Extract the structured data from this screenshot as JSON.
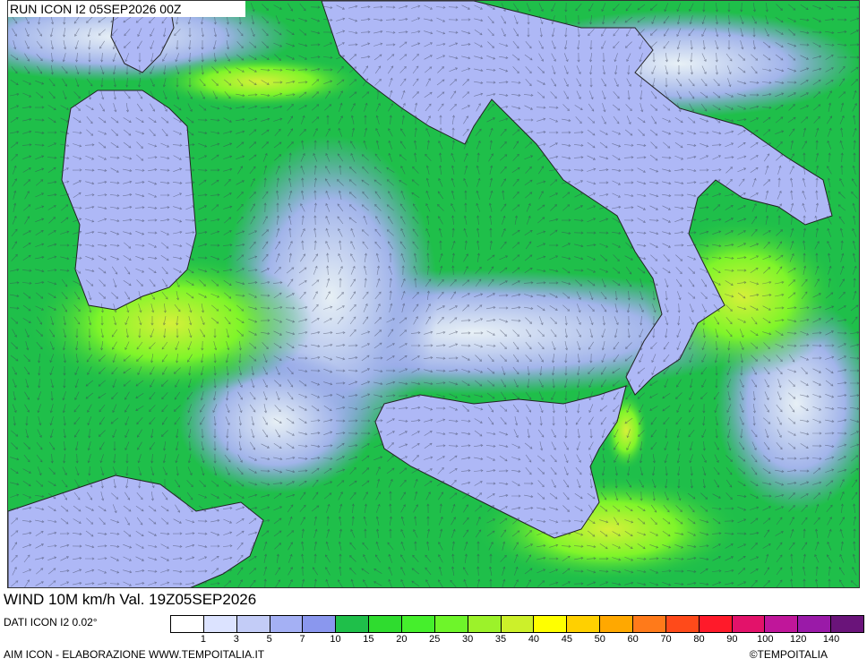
{
  "header": {
    "run_label": "RUN ICON I2 05SEP2026 00Z"
  },
  "footer": {
    "title": "WIND 10M km/h Val. 19Z05SEP2026",
    "source": "DATI ICON I2 0.02°",
    "credit": "AIM ICON - ELABORAZIONE WWW.TEMPOITALIA.IT",
    "copyright": "©TEMPOITALIA"
  },
  "legend": {
    "ticks": [
      "1",
      "3",
      "5",
      "7",
      "10",
      "15",
      "20",
      "25",
      "30",
      "35",
      "40",
      "45",
      "50",
      "60",
      "70",
      "80",
      "90",
      "100",
      "120",
      "140"
    ],
    "colors": [
      "#ffffff",
      "#dce3ff",
      "#c3ccf7",
      "#a4b0f4",
      "#8a97ee",
      "#1fbf4a",
      "#2fdc2f",
      "#45ef2c",
      "#6ef52a",
      "#9cf22a",
      "#ccf02a",
      "#ffff00",
      "#ffd000",
      "#ffa800",
      "#ff7a1a",
      "#ff4a1a",
      "#ff1a2a",
      "#e3126a",
      "#c0169a",
      "#9a1aa8",
      "#6a147a"
    ]
  },
  "map": {
    "land_color": "#aeb8f6",
    "sea_color": "#1fbf4a",
    "calm_color": "#e6e9ff",
    "strong_color": "#b6f02a",
    "coastline_color": "#222222",
    "arrow_color": "#3a3f55",
    "region_names": [
      "sardinia-island",
      "italy-mainland",
      "sicily-island",
      "tunisia-coast"
    ],
    "wind_field": "wind-arrow-field"
  }
}
